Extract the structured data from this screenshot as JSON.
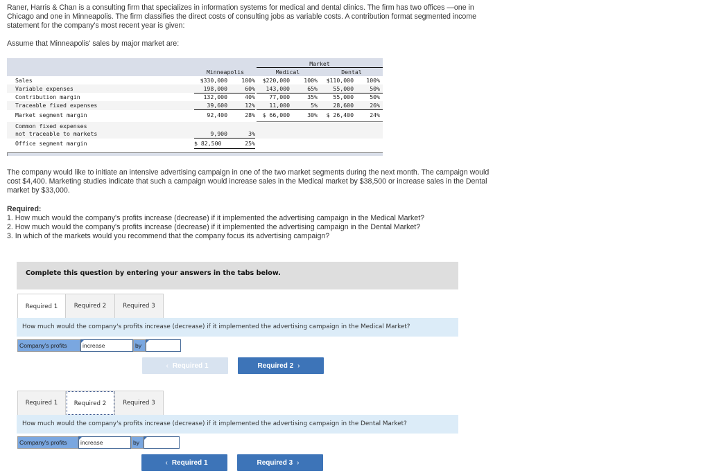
{
  "intro": {
    "paragraph": "Raner, Harris & Chan is a consulting firm that specializes in information systems for medical and dental clinics. The firm has two offices —one in Chicago and one in Minneapolis. The firm classifies the direct costs of consulting jobs as variable costs. A contribution format segmented income statement for the company's most recent year is given:",
    "assume": "Assume that Minneapolis' sales by major market are:"
  },
  "statement": {
    "headers": {
      "market": "Market",
      "minneapolis": "Minneapolis",
      "medical": "Medical",
      "dental": "Dental"
    },
    "rows": [
      {
        "label": "Sales",
        "minn": "$330,000",
        "minn_pct": "100%",
        "med": "$220,000",
        "med_pct": "100%",
        "den": "$110,000",
        "den_pct": "100%"
      },
      {
        "label": "Variable expenses",
        "minn": "198,000",
        "minn_pct": "60%",
        "med": "143,000",
        "med_pct": "65%",
        "den": "55,000",
        "den_pct": "50%"
      },
      {
        "label": "Contribution margin",
        "minn": "132,000",
        "minn_pct": "40%",
        "med": "77,000",
        "med_pct": "35%",
        "den": "55,000",
        "den_pct": "50%"
      },
      {
        "label": "Traceable fixed expenses",
        "minn": "39,600",
        "minn_pct": "12%",
        "med": "11,000",
        "med_pct": "5%",
        "den": "28,600",
        "den_pct": "26%"
      },
      {
        "label": "Market segment margin",
        "minn": "92,400",
        "minn_pct": "28%",
        "med": "$ 66,000",
        "med_pct": "30%",
        "den": "$ 26,400",
        "den_pct": "24%"
      },
      {
        "label": "Common fixed expenses",
        "label2": "not traceable to markets",
        "minn": "9,900",
        "minn_pct": "3%"
      },
      {
        "label": "Office segment margin",
        "minn": "$ 82,500",
        "minn_pct": "25%"
      }
    ]
  },
  "campaign": {
    "paragraph": "The company would like to initiate an intensive advertising campaign in one of the two market segments during the next month. The campaign would cost $4,400. Marketing studies indicate that such a campaign would increase sales in the Medical market by $38,500 or increase sales in the Dental market by $33,000."
  },
  "required": {
    "heading": "Required:",
    "items": [
      "1. How much would the company's profits increase (decrease) if it implemented the advertising campaign in the Medical Market?",
      "2. How much would the company's profits increase (decrease) if it implemented the advertising campaign in the Dental Market?",
      "3. In which of the markets would you recommend that the company focus its advertising campaign?"
    ]
  },
  "instruction": "Complete this question by entering your answers in the tabs below.",
  "panels": [
    {
      "tabs": [
        "Required 1",
        "Required 2",
        "Required 3"
      ],
      "active_tab": 0,
      "question": "How much would the company's profits increase (decrease) if it implemented the advertising campaign in the Medical Market?",
      "form": {
        "label": "Company's profits",
        "select_value": "increase",
        "by_label": "by",
        "amount_value": ""
      },
      "prev_button": "Required 1",
      "next_button": "Required 2",
      "prev_enabled": false
    },
    {
      "tabs": [
        "Required 1",
        "Required 2",
        "Required 3"
      ],
      "active_tab": 1,
      "question": "How much would the company's profits increase (decrease) if it implemented the advertising campaign in the Dental Market?",
      "form": {
        "label": "Company's profits",
        "select_value": "increase",
        "by_label": "by",
        "amount_value": ""
      },
      "prev_button": "Required 1",
      "next_button": "Required 3",
      "prev_enabled": true
    }
  ],
  "colors": {
    "primary_button": "#3d74b8",
    "question_bar": "#dcecf8",
    "form_label_bg": "#7aa7e0",
    "table_header_band": "#d9dee9"
  }
}
